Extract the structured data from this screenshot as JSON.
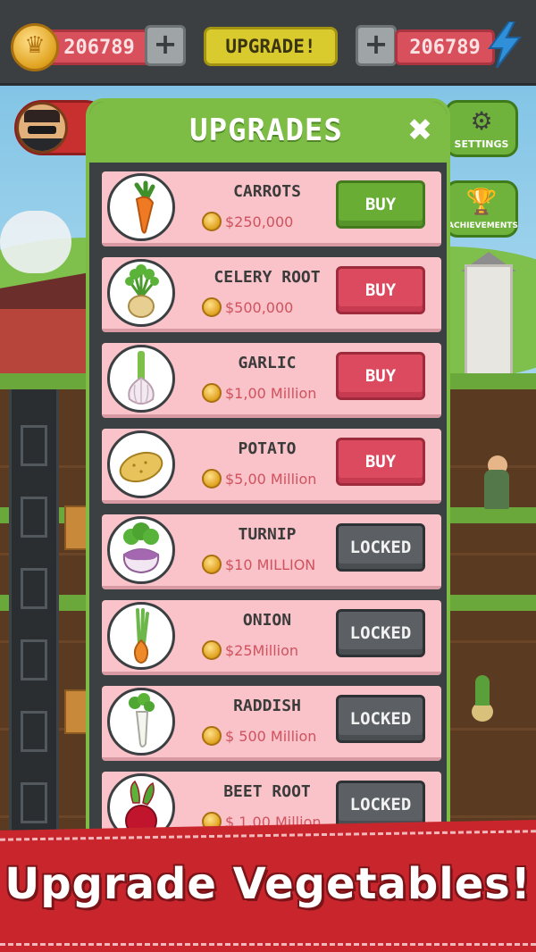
{
  "hud": {
    "coins_value": "206789",
    "plus_symbol": "+",
    "upgrade_label": "UPGRADE!",
    "energy_value": "206789"
  },
  "side_buttons": {
    "settings_label": "SETTINGS",
    "achievements_label": "ACHIEVEMENTS"
  },
  "panel": {
    "title": "UPGRADES",
    "close_symbol": "✖"
  },
  "upgrades": [
    {
      "name": "CARROTS",
      "price": "$250,000",
      "button": "BUY",
      "state": "buy",
      "icon": "carrot-icon"
    },
    {
      "name": "CELERY ROOT",
      "price": "$500,000",
      "button": "BUY",
      "state": "buy",
      "icon": "celery-root-icon"
    },
    {
      "name": "GARLIC",
      "price": "$1,00 Million",
      "button": "BUY",
      "state": "buy",
      "icon": "garlic-icon"
    },
    {
      "name": "POTATO",
      "price": "$5,00 Million",
      "button": "BUY",
      "state": "buy",
      "icon": "potato-icon"
    },
    {
      "name": "TURNIP",
      "price": "$10 MILLION",
      "button": "LOCKED",
      "state": "locked",
      "icon": "turnip-icon"
    },
    {
      "name": "ONION",
      "price": "$25Million",
      "button": "LOCKED",
      "state": "locked",
      "icon": "onion-icon"
    },
    {
      "name": "RADDISH",
      "price": "$ 500 Million",
      "button": "LOCKED",
      "state": "locked",
      "icon": "radish-icon"
    },
    {
      "name": "BEET ROOT",
      "price": "$ 1,00 Million",
      "button": "LOCKED",
      "state": "locked",
      "icon": "beet-root-icon"
    }
  ],
  "banner": {
    "text": "Upgrade Vegetables!"
  },
  "colors": {
    "panel_green": "#7ebd45",
    "row_pink": "#f9c3c9",
    "buy_green": "#69ad35",
    "buy_red": "#dc4a60",
    "locked_gray": "#5c6064",
    "banner_red": "#c8262c",
    "price_text": "#d0525f"
  }
}
